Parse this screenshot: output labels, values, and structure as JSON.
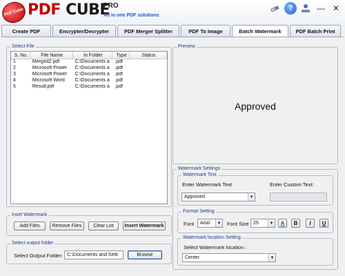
{
  "header": {
    "logo_badge": "PDF Cube",
    "logo_pdf": "PDF",
    "logo_cube": "CUBE",
    "logo_pro": "PRO",
    "tagline": "All in one PDF solutions",
    "icons": [
      "tools-icon",
      "help-icon",
      "minimize-icon",
      "close-icon"
    ]
  },
  "tabs": [
    {
      "label": "Create PDF",
      "active": false
    },
    {
      "label": "Encrypter/Decrypter",
      "active": false
    },
    {
      "label": "PDF Merger Splitter",
      "active": false
    },
    {
      "label": "PDF To Image",
      "active": false
    },
    {
      "label": "Batch Watermark",
      "active": true
    },
    {
      "label": "PDF Batch Print",
      "active": false
    }
  ],
  "select_file": {
    "title": "Select File",
    "columns": [
      "S. No.",
      "File Name",
      "In Folder",
      "Type",
      "Status"
    ],
    "rows": [
      {
        "no": "1",
        "name": "Merged2.pdf",
        "folder": "C:\\Documents a",
        "type": ".pdf",
        "status": ""
      },
      {
        "no": "2",
        "name": "Microsoft Power",
        "folder": "C:\\Documents a",
        "type": ".pdf",
        "status": ""
      },
      {
        "no": "3",
        "name": "Microsoft Power",
        "folder": "C:\\Documents a",
        "type": ".pdf",
        "status": ""
      },
      {
        "no": "4",
        "name": "Microsoft Word",
        "folder": "C:\\Documents a",
        "type": ".pdf",
        "status": ""
      },
      {
        "no": "5",
        "name": "Result.pdf",
        "folder": "C:\\Documents a",
        "type": ".pdf",
        "status": ""
      }
    ]
  },
  "inset_watermark": {
    "title": "Inset Watermark",
    "add_files": "Add Files",
    "remove_files": "Remove Files",
    "clear_list": "Clear List",
    "insert_watermark": "Insert Watermark"
  },
  "output_folder": {
    "title": "Select output folder",
    "label": "Select Output Folder:",
    "value": "C:\\Documents and Setti",
    "browse": "Browse"
  },
  "preview": {
    "title": "Preview",
    "text": "Approved"
  },
  "watermark_settings": {
    "title": "Watermark Settings",
    "text_group": "Watermark Text",
    "enter_text_label": "Enter Watermark Text",
    "text_value": "Approved",
    "custom_text_label": "Enter Custom Text:",
    "custom_text_value": "",
    "format_group": "Format Setting",
    "font_label": "Font",
    "font_value": "Arial",
    "size_label": "Font Size",
    "size_value": "25",
    "format_buttons": [
      "A",
      "B",
      "I",
      "U"
    ],
    "location_group": "Watermark location Setting",
    "location_label": "Select Watermark location :",
    "location_value": "Center"
  }
}
